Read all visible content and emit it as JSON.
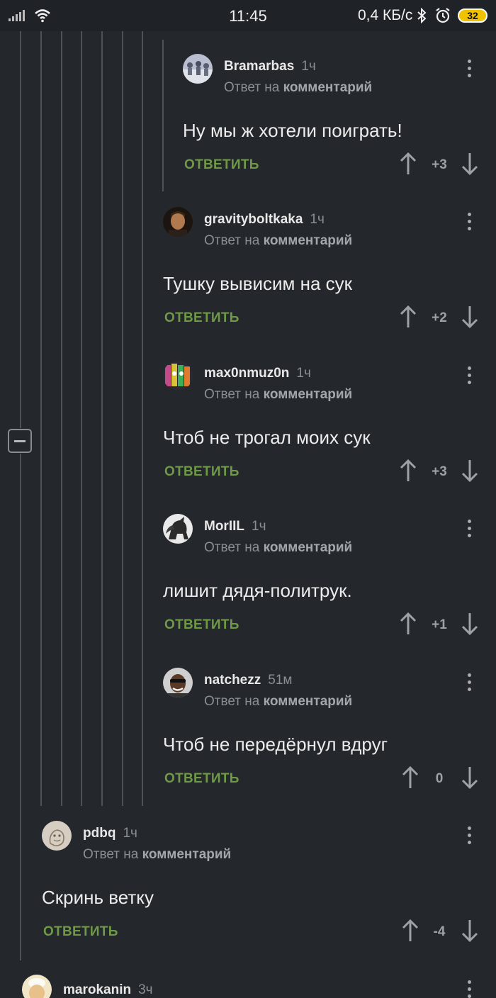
{
  "status_bar": {
    "time": "11:45",
    "network_speed": "0,4 КБ/с",
    "battery": "32",
    "icons": [
      "signal-icon",
      "wifi-icon",
      "bluetooth-icon",
      "alarm-icon",
      "battery-icon"
    ]
  },
  "colors": {
    "background": "#24272b",
    "accent_green": "#6e9a47",
    "muted_text": "#8b8f94"
  },
  "collapse_button": {
    "icon": "minus-icon"
  },
  "comments": [
    {
      "username": "Bramarbas",
      "time": "1ч",
      "reply_prefix": "Ответ на",
      "reply_link": "комментарий",
      "text": "Ну мы ж хотели поиграть!",
      "reply_label": "ОТВЕТИТЬ",
      "score": "+3"
    },
    {
      "username": "gravityboltkaka",
      "time": "1ч",
      "reply_prefix": "Ответ на",
      "reply_link": "комментарий",
      "text": "Тушку вывисим на сук",
      "reply_label": "ОТВЕТИТЬ",
      "score": "+2"
    },
    {
      "username": "max0nmuz0n",
      "time": "1ч",
      "reply_prefix": "Ответ на",
      "reply_link": "комментарий",
      "text": "Чтоб не трогал моих сук",
      "reply_label": "ОТВЕТИТЬ",
      "score": "+3"
    },
    {
      "username": "MorIIL",
      "time": "1ч",
      "reply_prefix": "Ответ на",
      "reply_link": "комментарий",
      "text": "лишит дядя-политрук.",
      "reply_label": "ОТВЕТИТЬ",
      "score": "+1"
    },
    {
      "username": "natchezz",
      "time": "51м",
      "reply_prefix": "Ответ на",
      "reply_link": "комментарий",
      "text": "Чтоб не передёрнул вдруг",
      "reply_label": "ОТВЕТИТЬ",
      "score": "0"
    },
    {
      "username": "pdbq",
      "time": "1ч",
      "reply_prefix": "Ответ на",
      "reply_link": "комментарий",
      "text": "Скринь ветку",
      "reply_label": "ОТВЕТИТЬ",
      "score": "-4"
    },
    {
      "username": "marokanin",
      "time": "3ч"
    }
  ]
}
